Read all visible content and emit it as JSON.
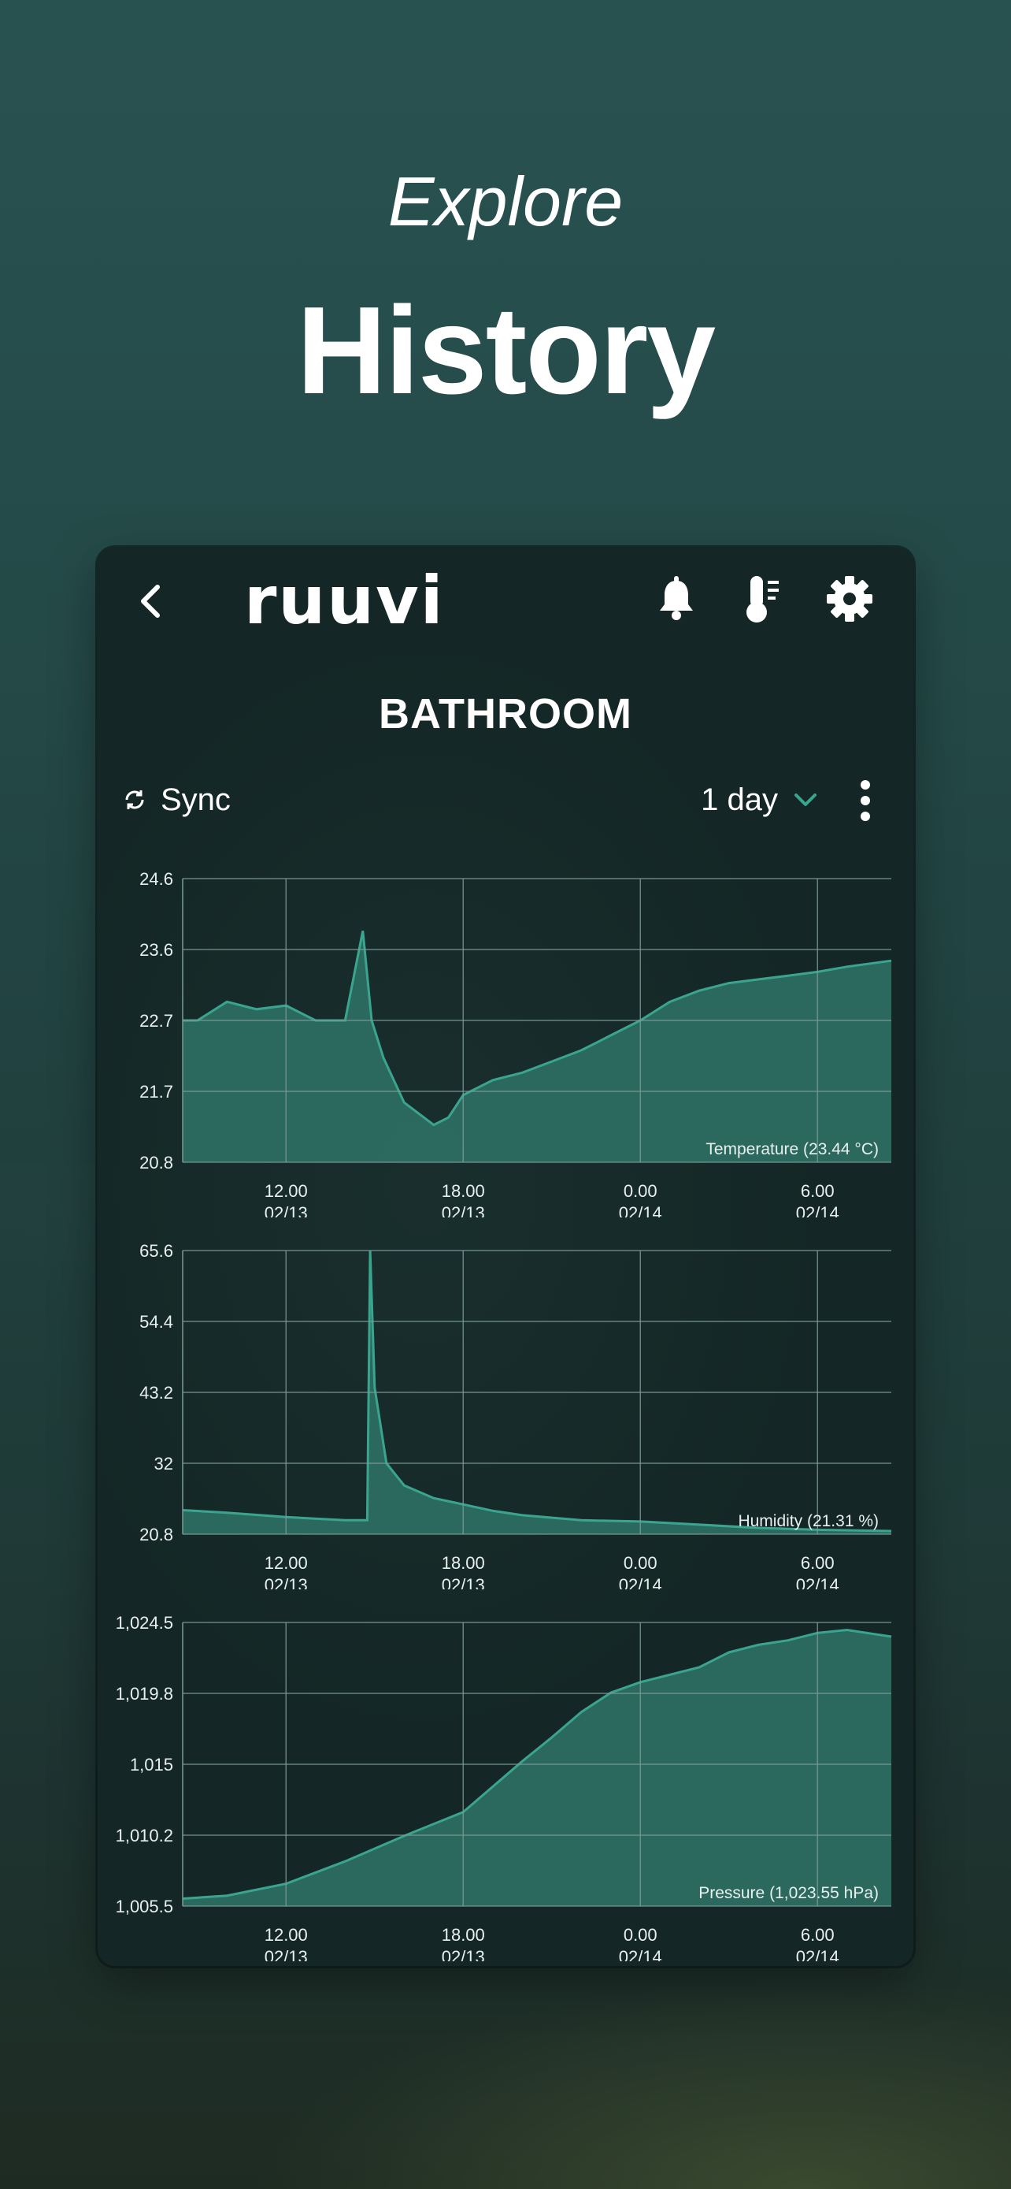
{
  "hero": {
    "subtitle": "Explore",
    "title": "History"
  },
  "appbar": {
    "logo": "ruuvi",
    "icons": [
      "back-icon",
      "bell-icon",
      "thermometer-icon",
      "gear-icon"
    ]
  },
  "device": {
    "name": "BATHROOM"
  },
  "controls": {
    "sync_label": "Sync",
    "range_label": "1 day"
  },
  "colors": {
    "accent": "#3aa58f",
    "fill": "#2e6f64",
    "grid": "#7a9a96"
  },
  "x_ticks": [
    {
      "time": "12.00",
      "date": "02/13"
    },
    {
      "time": "18.00",
      "date": "02/13"
    },
    {
      "time": "0.00",
      "date": "02/14"
    },
    {
      "time": "6.00",
      "date": "02/14"
    }
  ],
  "chart_data": [
    {
      "type": "area",
      "label": "Temperature (23.44 °C)",
      "y_ticks": [
        "24.6",
        "23.6",
        "22.7",
        "21.7",
        "20.8"
      ],
      "ylim": [
        20.8,
        24.6
      ],
      "x_hours": [
        8.5,
        9,
        10,
        11,
        12,
        13,
        14,
        14.6,
        14.9,
        15.3,
        16,
        17,
        17.5,
        18,
        19,
        20,
        21,
        22,
        23,
        0,
        1,
        2,
        3,
        4,
        5,
        6,
        7,
        8.5
      ],
      "x_hours_day": [
        0,
        0,
        0,
        0,
        0,
        0,
        0,
        0,
        0,
        0,
        0,
        0,
        0,
        0,
        0,
        0,
        0,
        0,
        0,
        1,
        1,
        1,
        1,
        1,
        1,
        1,
        1,
        1
      ],
      "values": [
        22.7,
        22.7,
        22.95,
        22.85,
        22.9,
        22.7,
        22.7,
        23.9,
        22.7,
        22.2,
        21.6,
        21.3,
        21.4,
        21.7,
        21.9,
        22.0,
        22.15,
        22.3,
        22.5,
        22.7,
        22.95,
        23.1,
        23.2,
        23.25,
        23.3,
        23.35,
        23.42,
        23.5
      ]
    },
    {
      "type": "area",
      "label": "Humidity (21.31 %)",
      "y_ticks": [
        "65.6",
        "54.4",
        "43.2",
        "32",
        "20.8"
      ],
      "ylim": [
        20.8,
        65.6
      ],
      "x_hours": [
        8.5,
        10,
        12,
        14,
        14.75,
        14.85,
        15.0,
        15.4,
        16,
        17,
        18,
        19,
        20,
        22,
        0,
        2,
        4,
        6,
        8.5
      ],
      "x_hours_day": [
        0,
        0,
        0,
        0,
        0,
        0,
        0,
        0,
        0,
        0,
        0,
        0,
        0,
        0,
        1,
        1,
        1,
        1,
        1
      ],
      "values": [
        24.6,
        24.2,
        23.5,
        23.0,
        23.0,
        65.6,
        44.0,
        32.0,
        28.5,
        26.5,
        25.5,
        24.5,
        23.8,
        23.0,
        22.8,
        22.3,
        21.8,
        21.5,
        21.3
      ]
    },
    {
      "type": "area",
      "label": "Pressure (1,023.55 hPa)",
      "y_ticks": [
        "1,024.5",
        "1,019.8",
        "1,015",
        "1,010.2",
        "1,005.5"
      ],
      "ylim": [
        1005.5,
        1024.5
      ],
      "x_hours": [
        8.5,
        10,
        12,
        14,
        16,
        18,
        19,
        20,
        21,
        22,
        23,
        0,
        1,
        2,
        3,
        4,
        5,
        6,
        7,
        8,
        8.5
      ],
      "x_hours_day": [
        0,
        0,
        0,
        0,
        0,
        0,
        0,
        0,
        0,
        0,
        0,
        1,
        1,
        1,
        1,
        1,
        1,
        1,
        1,
        1,
        1
      ],
      "values": [
        1006.0,
        1006.2,
        1007.0,
        1008.5,
        1010.2,
        1011.8,
        1013.5,
        1015.2,
        1016.8,
        1018.5,
        1019.8,
        1020.5,
        1021.0,
        1021.5,
        1022.5,
        1023.0,
        1023.3,
        1023.8,
        1024.0,
        1023.7,
        1023.55
      ]
    }
  ]
}
